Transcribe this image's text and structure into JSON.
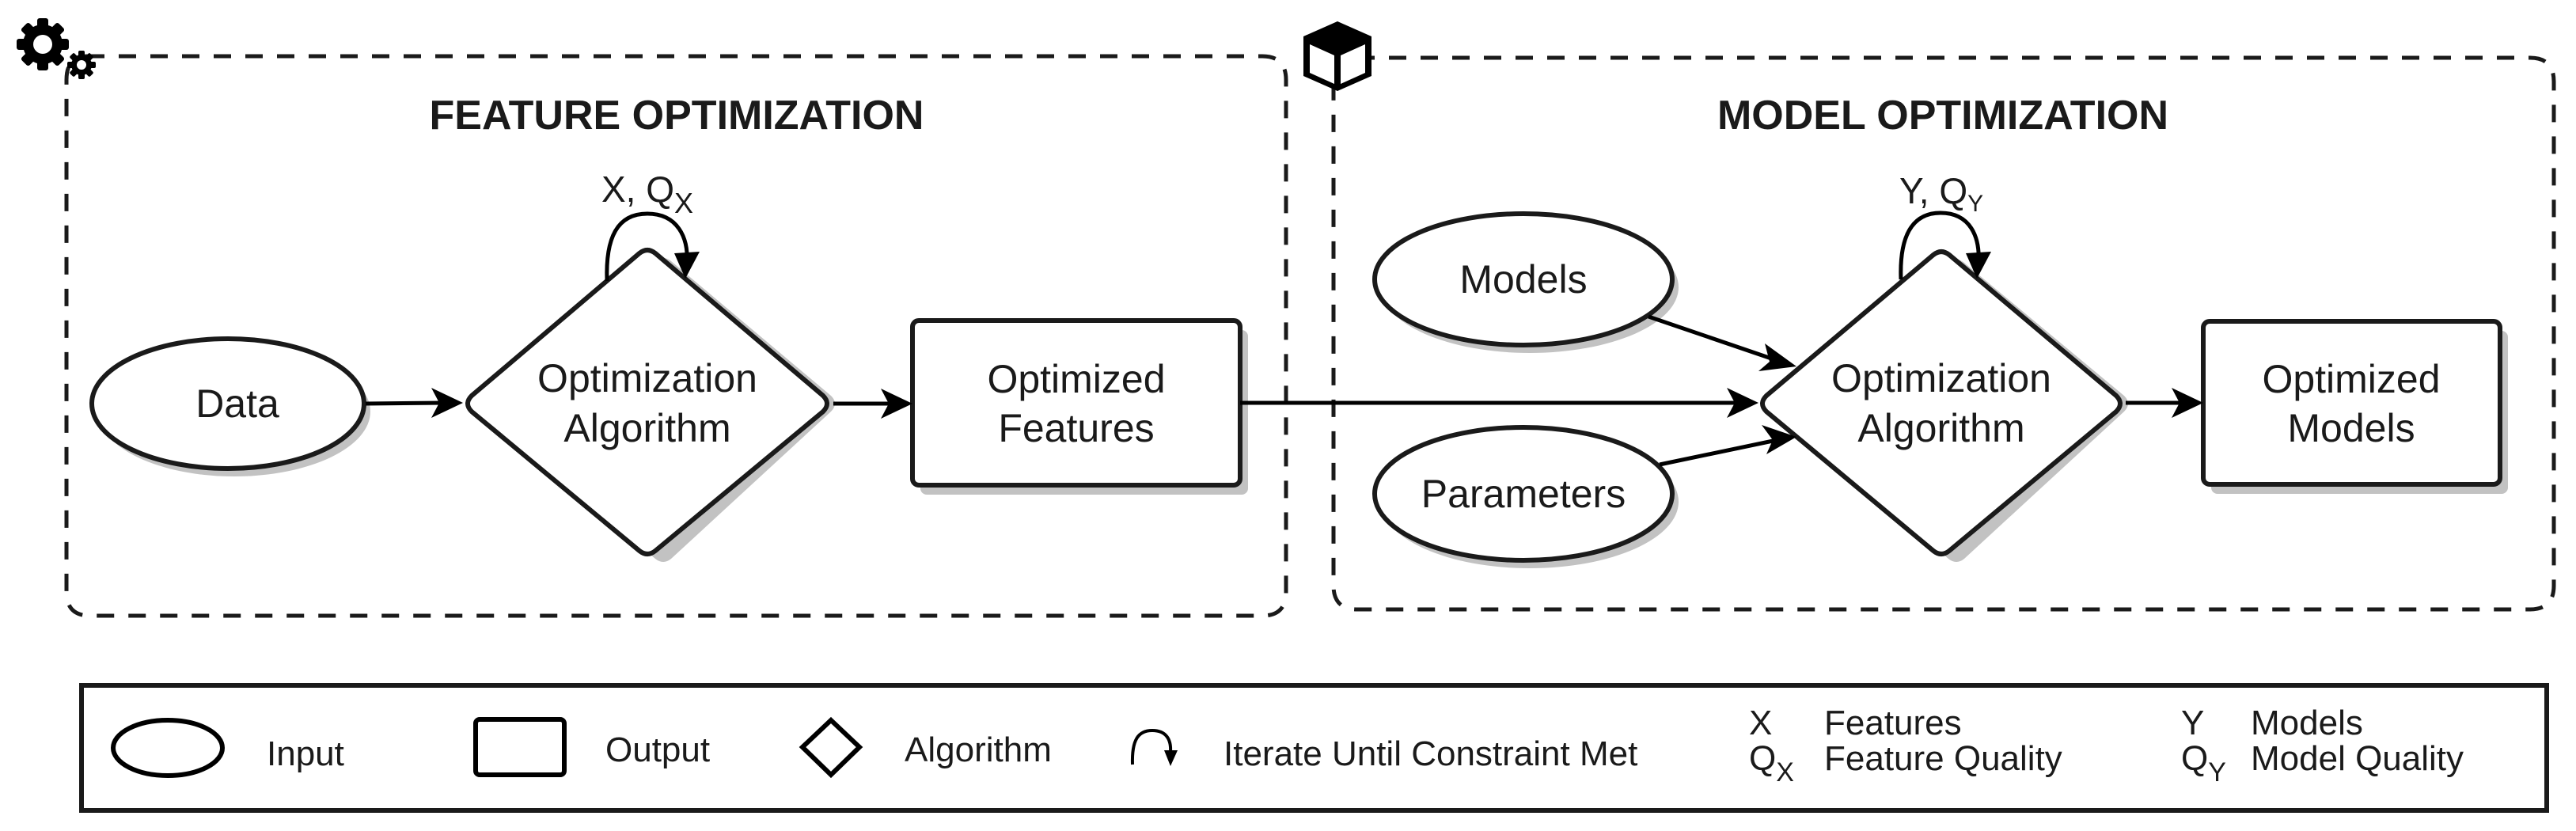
{
  "diagram": {
    "colors": {
      "stroke": "#1a1a1a",
      "shadow": "#c2c2c2",
      "background": "#ffffff"
    },
    "groups": [
      {
        "id": "feature",
        "title": "FEATURE OPTIMIZATION",
        "icon": "gears-icon",
        "nodes": [
          {
            "id": "data",
            "type": "input",
            "label_lines": [
              "Data"
            ]
          },
          {
            "id": "algo1",
            "type": "algorithm",
            "label_lines": [
              "Optimization",
              "Algorithm"
            ],
            "loop_label": {
              "main": "X, Q",
              "sub": "X"
            }
          },
          {
            "id": "features",
            "type": "output",
            "label_lines": [
              "Optimized",
              "Features"
            ]
          }
        ]
      },
      {
        "id": "model",
        "title": "MODEL OPTIMIZATION",
        "icon": "cube-icon",
        "nodes": [
          {
            "id": "models",
            "type": "input",
            "label_lines": [
              "Models"
            ]
          },
          {
            "id": "params",
            "type": "input",
            "label_lines": [
              "Parameters"
            ]
          },
          {
            "id": "algo2",
            "type": "algorithm",
            "label_lines": [
              "Optimization",
              "Algorithm"
            ],
            "loop_label": {
              "main": "Y, Q",
              "sub": "Y"
            }
          },
          {
            "id": "models_out",
            "type": "output",
            "label_lines": [
              "Optimized",
              "Models"
            ]
          }
        ]
      }
    ],
    "edges": [
      {
        "from": "data",
        "to": "algo1"
      },
      {
        "from": "algo1",
        "to": "features"
      },
      {
        "from": "features",
        "to": "algo2"
      },
      {
        "from": "models",
        "to": "algo2"
      },
      {
        "from": "params",
        "to": "algo2"
      },
      {
        "from": "algo2",
        "to": "models_out"
      }
    ],
    "legend": {
      "shapes": [
        {
          "shape": "ellipse",
          "label": "Input"
        },
        {
          "shape": "rectangle",
          "label": "Output"
        },
        {
          "shape": "diamond",
          "label": "Algorithm"
        },
        {
          "shape": "loop-arrow",
          "label": "Iterate Until Constraint Met"
        }
      ],
      "symbols": [
        {
          "symbol": "X",
          "sub": "",
          "label": "Features"
        },
        {
          "symbol": "Q",
          "sub": "X",
          "label": "Feature Quality"
        },
        {
          "symbol": "Y",
          "sub": "",
          "label": "Models"
        },
        {
          "symbol": "Q",
          "sub": "Y",
          "label": "Model Quality"
        }
      ]
    }
  }
}
